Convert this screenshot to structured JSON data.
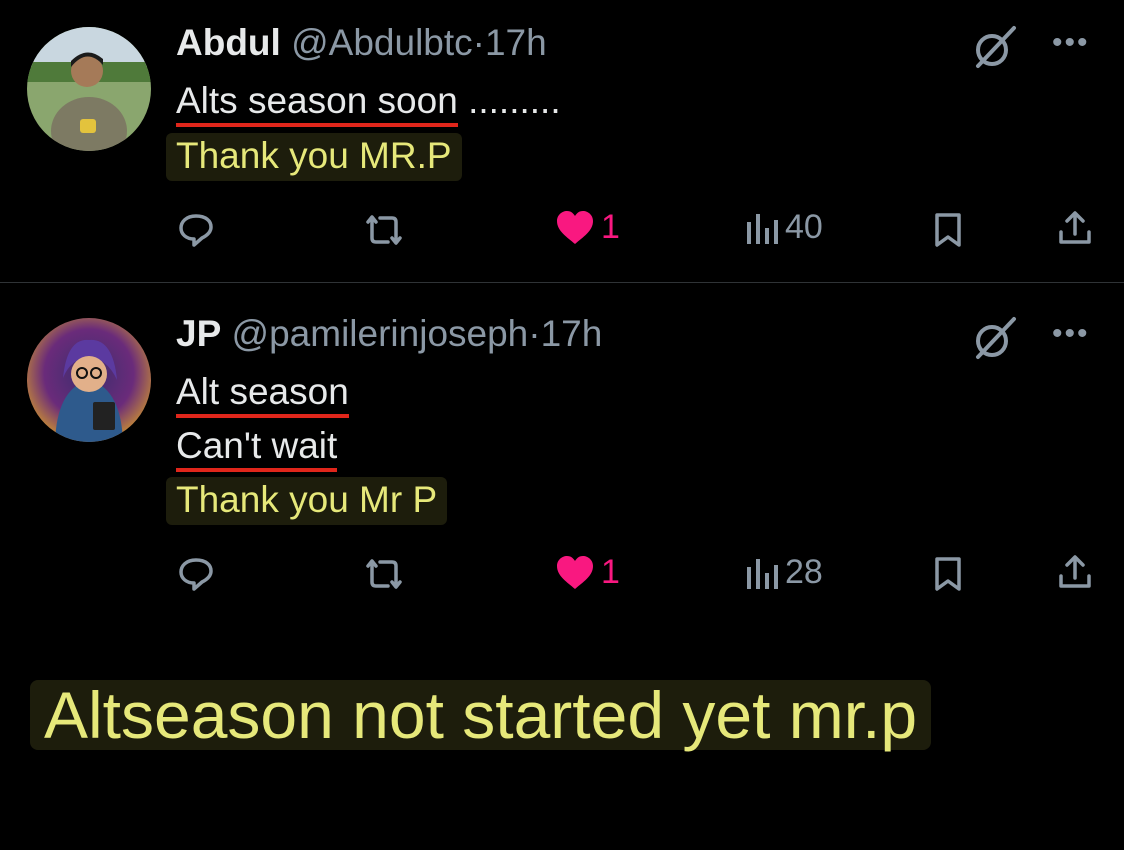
{
  "tweets": [
    {
      "name": "Abdul",
      "handle": "@Abdulbtc",
      "separator": "·",
      "time": "17h",
      "lines": [
        "Alts season  soon",
        "Thank you MR.P"
      ],
      "line1_suffix": " .........",
      "likes": "1",
      "views": "40",
      "avatar": "person-photo-avatar"
    },
    {
      "name": "JP",
      "handle": "@pamilerinjoseph",
      "separator": "·",
      "time": "17h",
      "lines": [
        "Alt season",
        "Can't wait",
        "Thank you Mr P"
      ],
      "likes": "1",
      "views": "28",
      "avatar": "illustrated-avatar"
    }
  ],
  "caption": "Altseason not started yet mr.p",
  "icons": [
    "grok-icon",
    "more-icon",
    "reply-icon",
    "retweet-icon",
    "like-icon",
    "views-icon",
    "bookmark-icon",
    "share-icon"
  ],
  "colors": {
    "background": "#000000",
    "like": "#f91880",
    "highlight_text": "#e6e87a",
    "underline": "#e0261b",
    "muted": "#8b98a5"
  }
}
